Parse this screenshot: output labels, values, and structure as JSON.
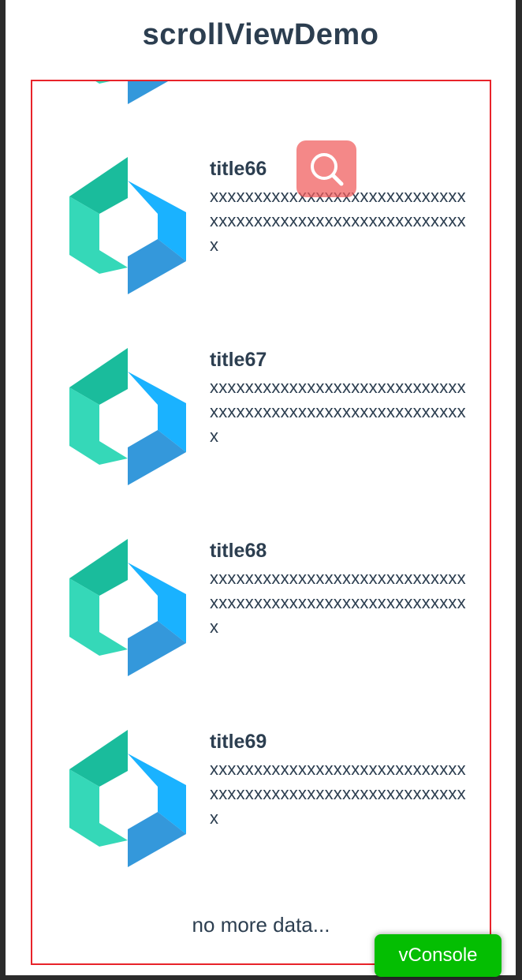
{
  "page": {
    "title": "scrollViewDemo"
  },
  "list": {
    "items": [
      {
        "title": "title66",
        "desc": "xxxxxxxxxxxxxxxxxxxxxxxxxxxxxxxxxxxxxxxxxxxxxxxxxxxxxxxxxxx"
      },
      {
        "title": "title67",
        "desc": "xxxxxxxxxxxxxxxxxxxxxxxxxxxxxxxxxxxxxxxxxxxxxxxxxxxxxxxxxxx"
      },
      {
        "title": "title68",
        "desc": "xxxxxxxxxxxxxxxxxxxxxxxxxxxxxxxxxxxxxxxxxxxxxxxxxxxxxxxxxxx"
      },
      {
        "title": "title69",
        "desc": "xxxxxxxxxxxxxxxxxxxxxxxxxxxxxxxxxxxxxxxxxxxxxxxxxxxxxxxxxxx"
      }
    ],
    "footer": "no more data...",
    "item_icon": "hexagon-logo-icon"
  },
  "floating": {
    "search_icon": "search-icon",
    "vconsole_label": "vConsole"
  },
  "colors": {
    "title_text": "#2c3e50",
    "scroll_border": "#e8232a",
    "search_fab": "#f05a5a",
    "vconsole_bg": "#04be02",
    "logo_teal_dark": "#1abc9c",
    "logo_teal_light": "#35d8b8",
    "logo_blue_light": "#1ab2ff",
    "logo_blue_dark": "#3498db"
  }
}
